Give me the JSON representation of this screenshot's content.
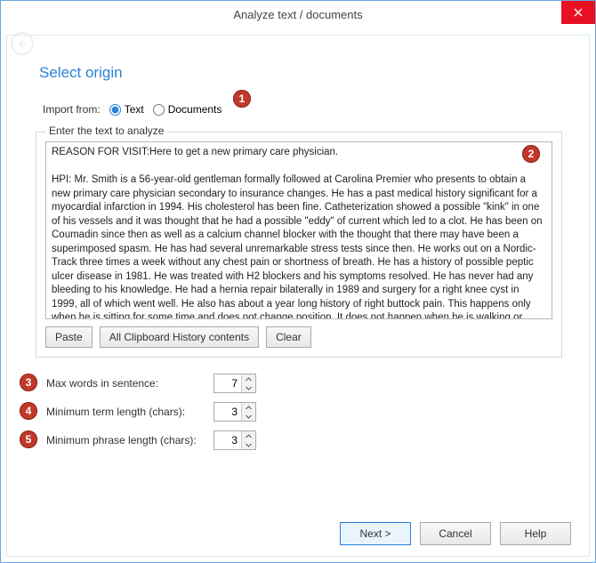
{
  "window": {
    "title": "Analyze text / documents"
  },
  "heading": "Select origin",
  "import": {
    "label": "Import from:",
    "text_label": "Text",
    "documents_label": "Documents"
  },
  "fieldset": {
    "legend": "Enter the text to analyze",
    "text": "REASON FOR VISIT:Here to get a new primary care physician.\n\nHPI: Mr. Smith is a 56-year-old gentleman formally followed at Carolina Premier who presents to obtain a new primary care physician secondary to insurance changes. He has a past medical history significant for a myocardial infarction in 1994. His cholesterol has been fine. Catheterization showed a possible \"kink\" in one of his vessels and it was thought that he had a possible \"eddy\" of current which led to a clot. He has been on Coumadin since then as well as a calcium channel blocker with the thought that there may have been a superimposed spasm. He has had several unremarkable stress tests since then. He works out on a Nordic-Track three times a week without any chest pain or shortness of breath. He has a history of possible peptic ulcer disease in 1981. He was treated with H2 blockers and his symptoms resolved. He has never had any bleeding to his knowledge. He had a hernia repair bilaterally in 1989 and surgery for a right knee cyst in 1999, all of which went well. He also has about a year long history of right buttock pain. This happens only when he is sitting for some time and does not change position. It does not happen when he is walking or exercising. He wonders if it might be pyriformis syndrome. If he changes positions frequently or stretches his legs, this seems to help. He has no acute complaints today and is here to get plugged into the system. He does wonder if there is anything else that can be done about his buttock pain.",
    "paste_label": "Paste",
    "clipboard_label": "All Clipboard History contents",
    "clear_label": "Clear"
  },
  "params": {
    "max_words": {
      "label": "Max words in sentence:",
      "value": "7"
    },
    "min_term": {
      "label": "Minimum term length (chars):",
      "value": "3"
    },
    "min_phrase": {
      "label": "Minimum phrase length (chars):",
      "value": "3"
    }
  },
  "footer": {
    "next": "Next >",
    "cancel": "Cancel",
    "help": "Help"
  },
  "callouts": {
    "c1": "1",
    "c2": "2",
    "c3": "3",
    "c4": "4",
    "c5": "5"
  }
}
